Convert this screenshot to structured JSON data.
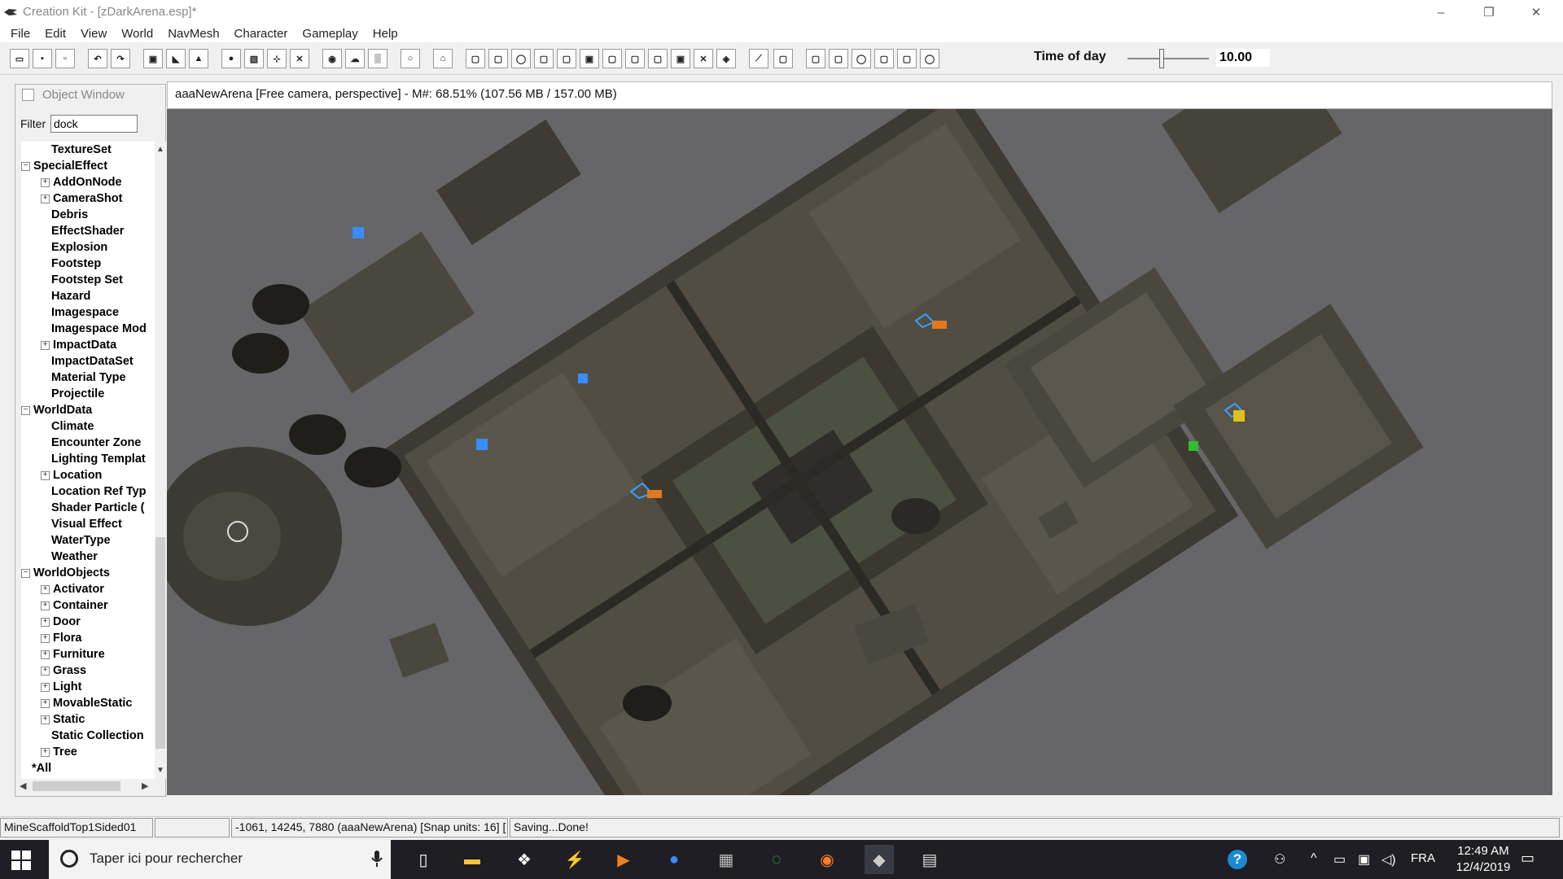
{
  "window": {
    "title": "Creation Kit - [zDarkArena.esp]*",
    "controls": [
      "–",
      "❐",
      "✕"
    ]
  },
  "menu": [
    "File",
    "Edit",
    "View",
    "World",
    "NavMesh",
    "Character",
    "Gameplay",
    "Help"
  ],
  "toolbar": {
    "time_of_day_label": "Time of day",
    "time_of_day_value": "10.00",
    "time_of_day_level": 0.42
  },
  "object_window": {
    "title": "Object Window",
    "filter_label": "Filter",
    "filter_value": "dock",
    "tree": [
      {
        "label": "TextureSet",
        "level": 1,
        "expander": ""
      },
      {
        "label": "SpecialEffect",
        "level": 0,
        "expander": "−"
      },
      {
        "label": "AddOnNode",
        "level": 1,
        "expander": "+"
      },
      {
        "label": "CameraShot",
        "level": 1,
        "expander": "+"
      },
      {
        "label": "Debris",
        "level": 1,
        "expander": ""
      },
      {
        "label": "EffectShader",
        "level": 1,
        "expander": ""
      },
      {
        "label": "Explosion",
        "level": 1,
        "expander": ""
      },
      {
        "label": "Footstep",
        "level": 1,
        "expander": ""
      },
      {
        "label": "Footstep Set",
        "level": 1,
        "expander": ""
      },
      {
        "label": "Hazard",
        "level": 1,
        "expander": ""
      },
      {
        "label": "Imagespace",
        "level": 1,
        "expander": ""
      },
      {
        "label": "Imagespace Mod",
        "level": 1,
        "expander": ""
      },
      {
        "label": "ImpactData",
        "level": 1,
        "expander": "+"
      },
      {
        "label": "ImpactDataSet",
        "level": 1,
        "expander": ""
      },
      {
        "label": "Material Type",
        "level": 1,
        "expander": ""
      },
      {
        "label": "Projectile",
        "level": 1,
        "expander": ""
      },
      {
        "label": "WorldData",
        "level": 0,
        "expander": "−"
      },
      {
        "label": "Climate",
        "level": 1,
        "expander": ""
      },
      {
        "label": "Encounter Zone",
        "level": 1,
        "expander": ""
      },
      {
        "label": "Lighting Templat",
        "level": 1,
        "expander": ""
      },
      {
        "label": "Location",
        "level": 1,
        "expander": "+"
      },
      {
        "label": "Location Ref Typ",
        "level": 1,
        "expander": ""
      },
      {
        "label": "Shader Particle (",
        "level": 1,
        "expander": ""
      },
      {
        "label": "Visual Effect",
        "level": 1,
        "expander": ""
      },
      {
        "label": "WaterType",
        "level": 1,
        "expander": ""
      },
      {
        "label": "Weather",
        "level": 1,
        "expander": ""
      },
      {
        "label": "WorldObjects",
        "level": 0,
        "expander": "−"
      },
      {
        "label": "Activator",
        "level": 1,
        "expander": "+"
      },
      {
        "label": "Container",
        "level": 1,
        "expander": "+"
      },
      {
        "label": "Door",
        "level": 1,
        "expander": "+"
      },
      {
        "label": "Flora",
        "level": 1,
        "expander": "+"
      },
      {
        "label": "Furniture",
        "level": 1,
        "expander": "+"
      },
      {
        "label": "Grass",
        "level": 1,
        "expander": "+"
      },
      {
        "label": "Light",
        "level": 1,
        "expander": "+"
      },
      {
        "label": "MovableStatic",
        "level": 1,
        "expander": "+"
      },
      {
        "label": "Static",
        "level": 1,
        "expander": "+"
      },
      {
        "label": "Static Collection",
        "level": 1,
        "expander": ""
      },
      {
        "label": "Tree",
        "level": 1,
        "expander": "+"
      },
      {
        "label": "*All",
        "level": 0,
        "expander": ""
      }
    ]
  },
  "viewport": {
    "title": "aaaNewArena [Free camera, perspective] - M#: 68.51% (107.56 MB / 157.00 MB)"
  },
  "status_bar": {
    "selection": "MineScaffoldTop1Sided01",
    "empty": "",
    "coords": "-1061, 14245, 7880 (aaaNewArena) [Snap units: 16] [",
    "message": "Saving...Done!"
  },
  "taskbar": {
    "search_placeholder": "Taper ici pour rechercher",
    "language": "FRA",
    "time": "12:49 AM",
    "date": "12/4/2019"
  },
  "colors": {
    "viewport_bg": "#666669",
    "stone": "#4a473e",
    "taskbar": "#1e1e24"
  }
}
